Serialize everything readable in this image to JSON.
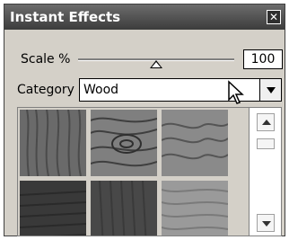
{
  "window": {
    "title": "Instant Effects",
    "close_icon": "close-icon",
    "close_symbol": "✕"
  },
  "scale": {
    "label": "Scale %",
    "value": "100",
    "slider_value": 100
  },
  "category": {
    "label": "Category",
    "selected": "Wood",
    "dropdown_icon": "chevron-down-icon"
  },
  "gallery": {
    "thumbnails": [
      {
        "name": "wood-texture-1",
        "color": "#6a6a6a"
      },
      {
        "name": "wood-texture-2",
        "color": "#7f7f7f"
      },
      {
        "name": "wood-texture-3",
        "color": "#8a8a8a"
      },
      {
        "name": "wood-texture-4",
        "color": "#393939"
      },
      {
        "name": "wood-texture-5",
        "color": "#484848"
      },
      {
        "name": "wood-texture-6",
        "color": "#9a9a9a"
      }
    ],
    "scroll_up_icon": "chevron-up-icon",
    "scroll_down_icon": "chevron-down-icon"
  },
  "cursor": {
    "icon": "arrow-cursor-icon"
  }
}
